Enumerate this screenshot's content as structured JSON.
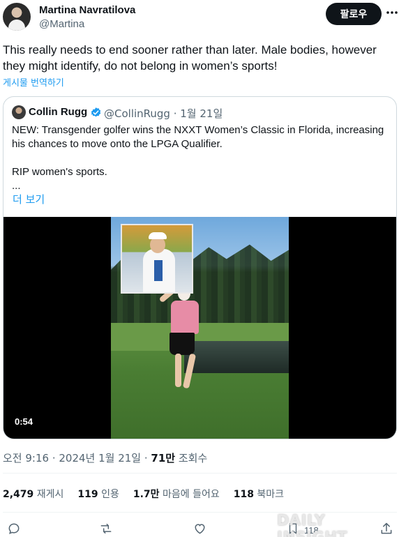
{
  "author": {
    "name": "Martina Navratilova",
    "handle": "@Martina",
    "avatar_icon": "user-avatar"
  },
  "follow_label": "팔로우",
  "more_icon": "more-dots-icon",
  "tweet": {
    "text": "This really needs to end sooner rather than later.  Male bodies, however\nthey might identify, do not belong in women’s sports!",
    "translate_label": "게시물 번역하기"
  },
  "quote": {
    "name": "Collin Rugg",
    "verified_icon": "verified-badge-icon",
    "meta": "@CollinRugg · 1월 21일",
    "text": "NEW: Transgender golfer wins the NXXT Women’s Classic in Florida, increasing\nhis chances to move onto the LPGA Qualifier.\n\nRIP women's sports.\n...",
    "show_more": "더 보기",
    "video_time": "0:54"
  },
  "timestamp": {
    "time": "오전 9:16 · 2024년 1월 21일 · ",
    "views_count": "71만",
    "views_label": " 조회수"
  },
  "stats": {
    "reposts_count": "2,479",
    "reposts_label": "재게시",
    "quotes_count": "119",
    "quotes_label": "인용",
    "likes_count": "1.7만",
    "likes_label": "마음에 들어요",
    "bookmarks_count": "118",
    "bookmarks_label": "북마크"
  },
  "actions": {
    "bookmark_count": "118"
  },
  "watermark": "DAILY INSIGHT",
  "colors": {
    "accent": "#1d9bf0",
    "text": "#0f1419",
    "muted": "#536471",
    "border": "#cfd9de"
  }
}
